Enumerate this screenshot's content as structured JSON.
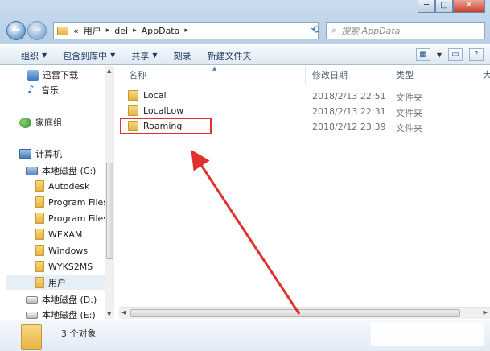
{
  "window": {
    "minimize": "─",
    "maximize": "□",
    "close": "✕"
  },
  "address": {
    "chevron": "«",
    "crumbs": [
      "用户",
      "del",
      "AppData"
    ],
    "separator": "▸"
  },
  "search": {
    "placeholder": "搜索 AppData"
  },
  "toolbar": {
    "organize": "组织",
    "include_in_library": "包含到库中",
    "share": "共享",
    "burn": "刻录",
    "new_folder": "新建文件夹"
  },
  "nav": {
    "downloads": "迅雷下载",
    "music": "音乐",
    "homegroup": "家庭组",
    "computer": "计算机",
    "drive_c": "本地磁盘 (C:)",
    "folders": [
      "Autodesk",
      "Program Files",
      "Program Files",
      "WEXAM",
      "Windows",
      "WYKS2MS",
      "用户"
    ],
    "drive_d": "本地磁盘 (D:)",
    "drive_e": "本地磁盘 (E:)"
  },
  "columns": {
    "name": "名称",
    "modified": "修改日期",
    "type": "类型",
    "size": "大小"
  },
  "files": [
    {
      "name": "Local",
      "modified": "2018/2/13 22:51",
      "type": "文件夹"
    },
    {
      "name": "LocalLow",
      "modified": "2018/2/13 22:31",
      "type": "文件夹"
    },
    {
      "name": "Roaming",
      "modified": "2018/2/12 23:39",
      "type": "文件夹"
    }
  ],
  "status": {
    "item_count": "3 个对象"
  },
  "colors": {
    "highlight_box": "#e0312d",
    "arrow": "#e0312d"
  },
  "icons": {
    "back": "back-arrow-icon",
    "forward": "forward-arrow-icon",
    "refresh": "refresh-icon",
    "search": "search-icon",
    "help": "help-icon"
  }
}
